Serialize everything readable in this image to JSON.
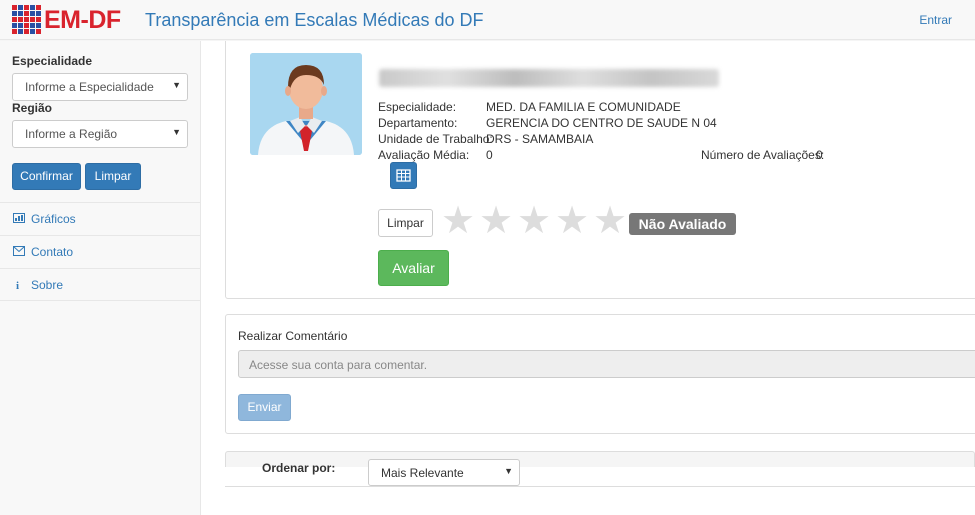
{
  "app": {
    "logo_text": "EM-DF",
    "title": "Transparência em Escalas Médicas do DF",
    "login_link": "Entrar"
  },
  "sidebar": {
    "specialty_label": "Especialidade",
    "specialty_selected": "Informe a Especialidade",
    "region_label": "Região",
    "region_selected": "Informe a Região",
    "confirm_label": "Confirmar",
    "clear_label": "Limpar",
    "nav": [
      {
        "label": "Gráficos",
        "icon": "bar-chart-icon"
      },
      {
        "label": "Contato",
        "icon": "envelope-icon"
      },
      {
        "label": "Sobre",
        "icon": "info-icon"
      }
    ]
  },
  "doctor": {
    "specialty_label": "Especialidade:",
    "specialty_value": "MED. DA FAMILIA E COMUNIDADE",
    "department_label": "Departamento:",
    "department_value": "GERENCIA DO CENTRO DE SAUDE N 04",
    "unit_label": "Unidade de Trabalho:",
    "unit_value": "DRS - SAMAMBAIA",
    "avg_label": "Avaliação Média:",
    "avg_value": "0",
    "count_label": "Número de Avaliações:",
    "count_value": "0",
    "clear_label": "Limpar",
    "rating_stars": 0,
    "rating_max": 5,
    "status_badge": "Não Avaliado",
    "evaluate_label": "Avaliar"
  },
  "comment": {
    "label": "Realizar Comentário",
    "placeholder": "Acesse sua conta para comentar.",
    "send_label": "Enviar"
  },
  "sort": {
    "label": "Ordenar por:",
    "selected": "Mais Relevante"
  },
  "colors": {
    "primary": "#337ab7",
    "success": "#5cb85c",
    "badge": "#777777",
    "logo_red": "#d9232d",
    "logo_blue": "#2a4fa3"
  }
}
